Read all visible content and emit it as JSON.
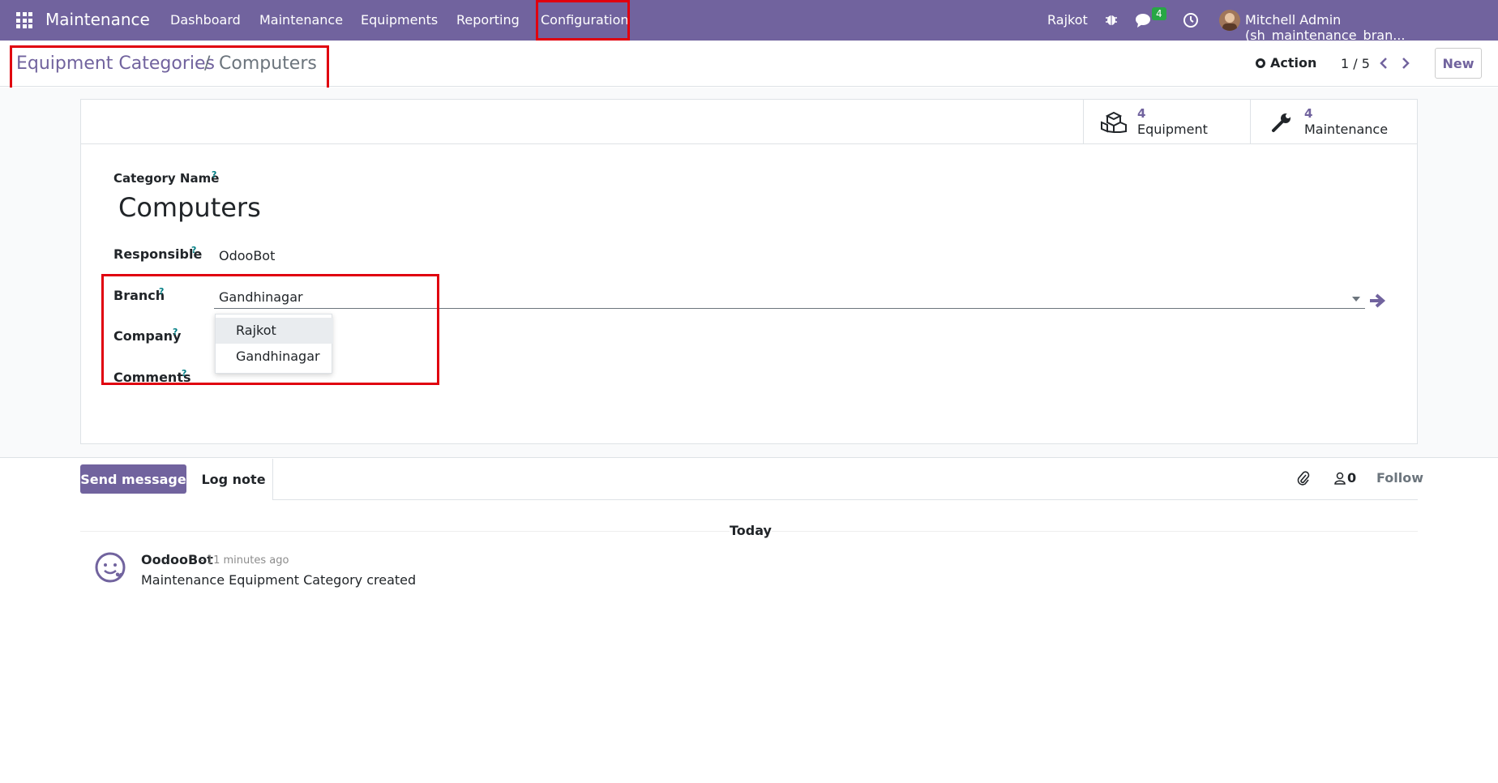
{
  "navbar": {
    "app_name": "Maintenance",
    "menus": [
      "Dashboard",
      "Maintenance",
      "Equipments",
      "Reporting",
      "Configuration"
    ],
    "branch": "Rajkot",
    "chat_count": "4",
    "user": "Mitchell Admin (sh_maintenance_bran..."
  },
  "breadcrumb": {
    "parent": "Equipment Categories",
    "separator": "/",
    "current": "Computers"
  },
  "toolbar": {
    "action_label": "Action",
    "pager": "1 / 5",
    "new_label": "New"
  },
  "stat_buttons": {
    "equipment": {
      "count": "4",
      "label": "Equipment"
    },
    "maintenance": {
      "count": "4",
      "label": "Maintenance"
    }
  },
  "form": {
    "category_name_label": "Category Name",
    "category_name": "Computers",
    "responsible_label": "Responsible",
    "responsible": "OdooBot",
    "branch_label": "Branch",
    "branch": "Gandhinagar",
    "company_label": "Company",
    "comments_label": "Comments",
    "help_mark": "?",
    "branch_options": [
      "Rajkot",
      "Gandhinagar"
    ]
  },
  "chatter": {
    "send_message": "Send message",
    "log_note": "Log note",
    "followers_count": "0",
    "follow": "Follow",
    "today": "Today",
    "message": {
      "author": "OodooBot",
      "time": "- 11 minutes ago",
      "body": "Maintenance Equipment Category created"
    }
  },
  "colors": {
    "brand": "#71639e",
    "highlight": "#e0000f"
  }
}
